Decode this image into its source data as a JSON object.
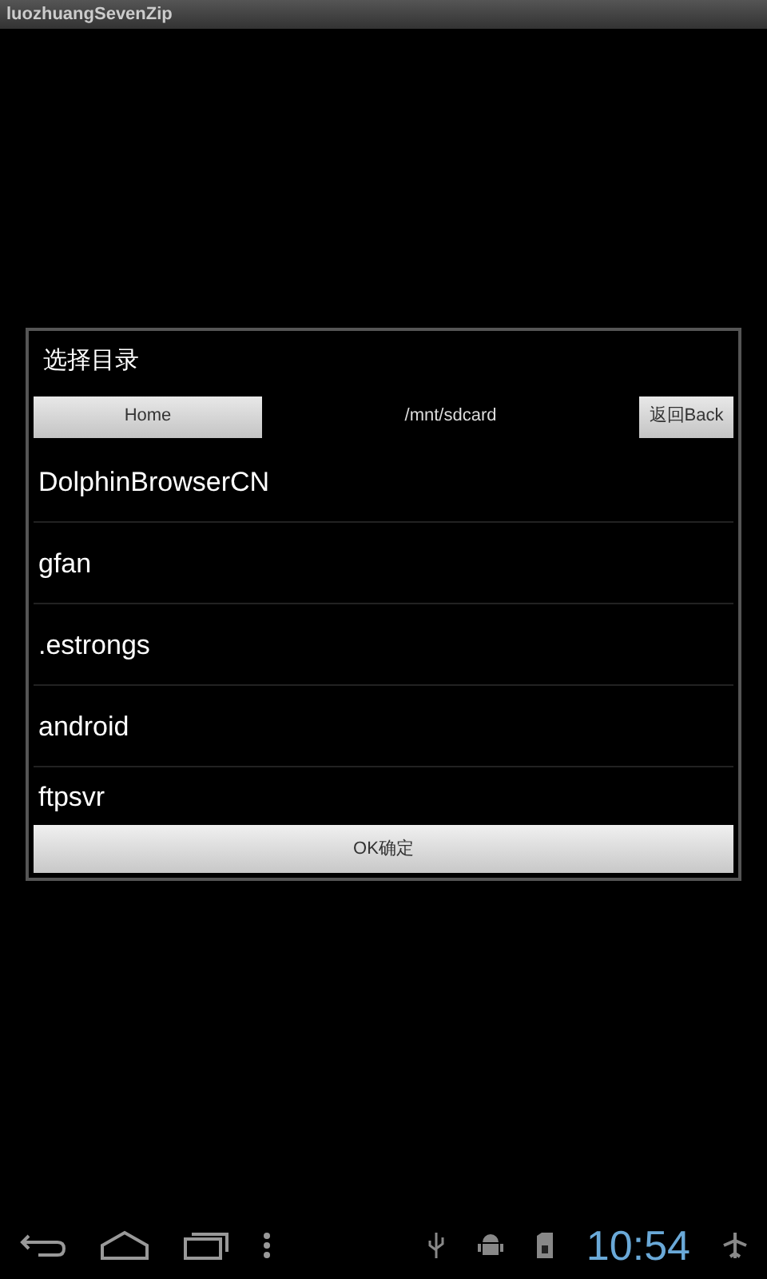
{
  "app_title": "luozhuangSevenZip",
  "dialog": {
    "title": "选择目录",
    "home_button": "Home",
    "path": "/mnt/sdcard",
    "back_button": "返回Back",
    "folders": [
      "DolphinBrowserCN",
      "gfan",
      ".estrongs",
      "android",
      "ftpsvr"
    ],
    "ok_button": "OK确定"
  },
  "status_bar": {
    "time": "10:54"
  }
}
